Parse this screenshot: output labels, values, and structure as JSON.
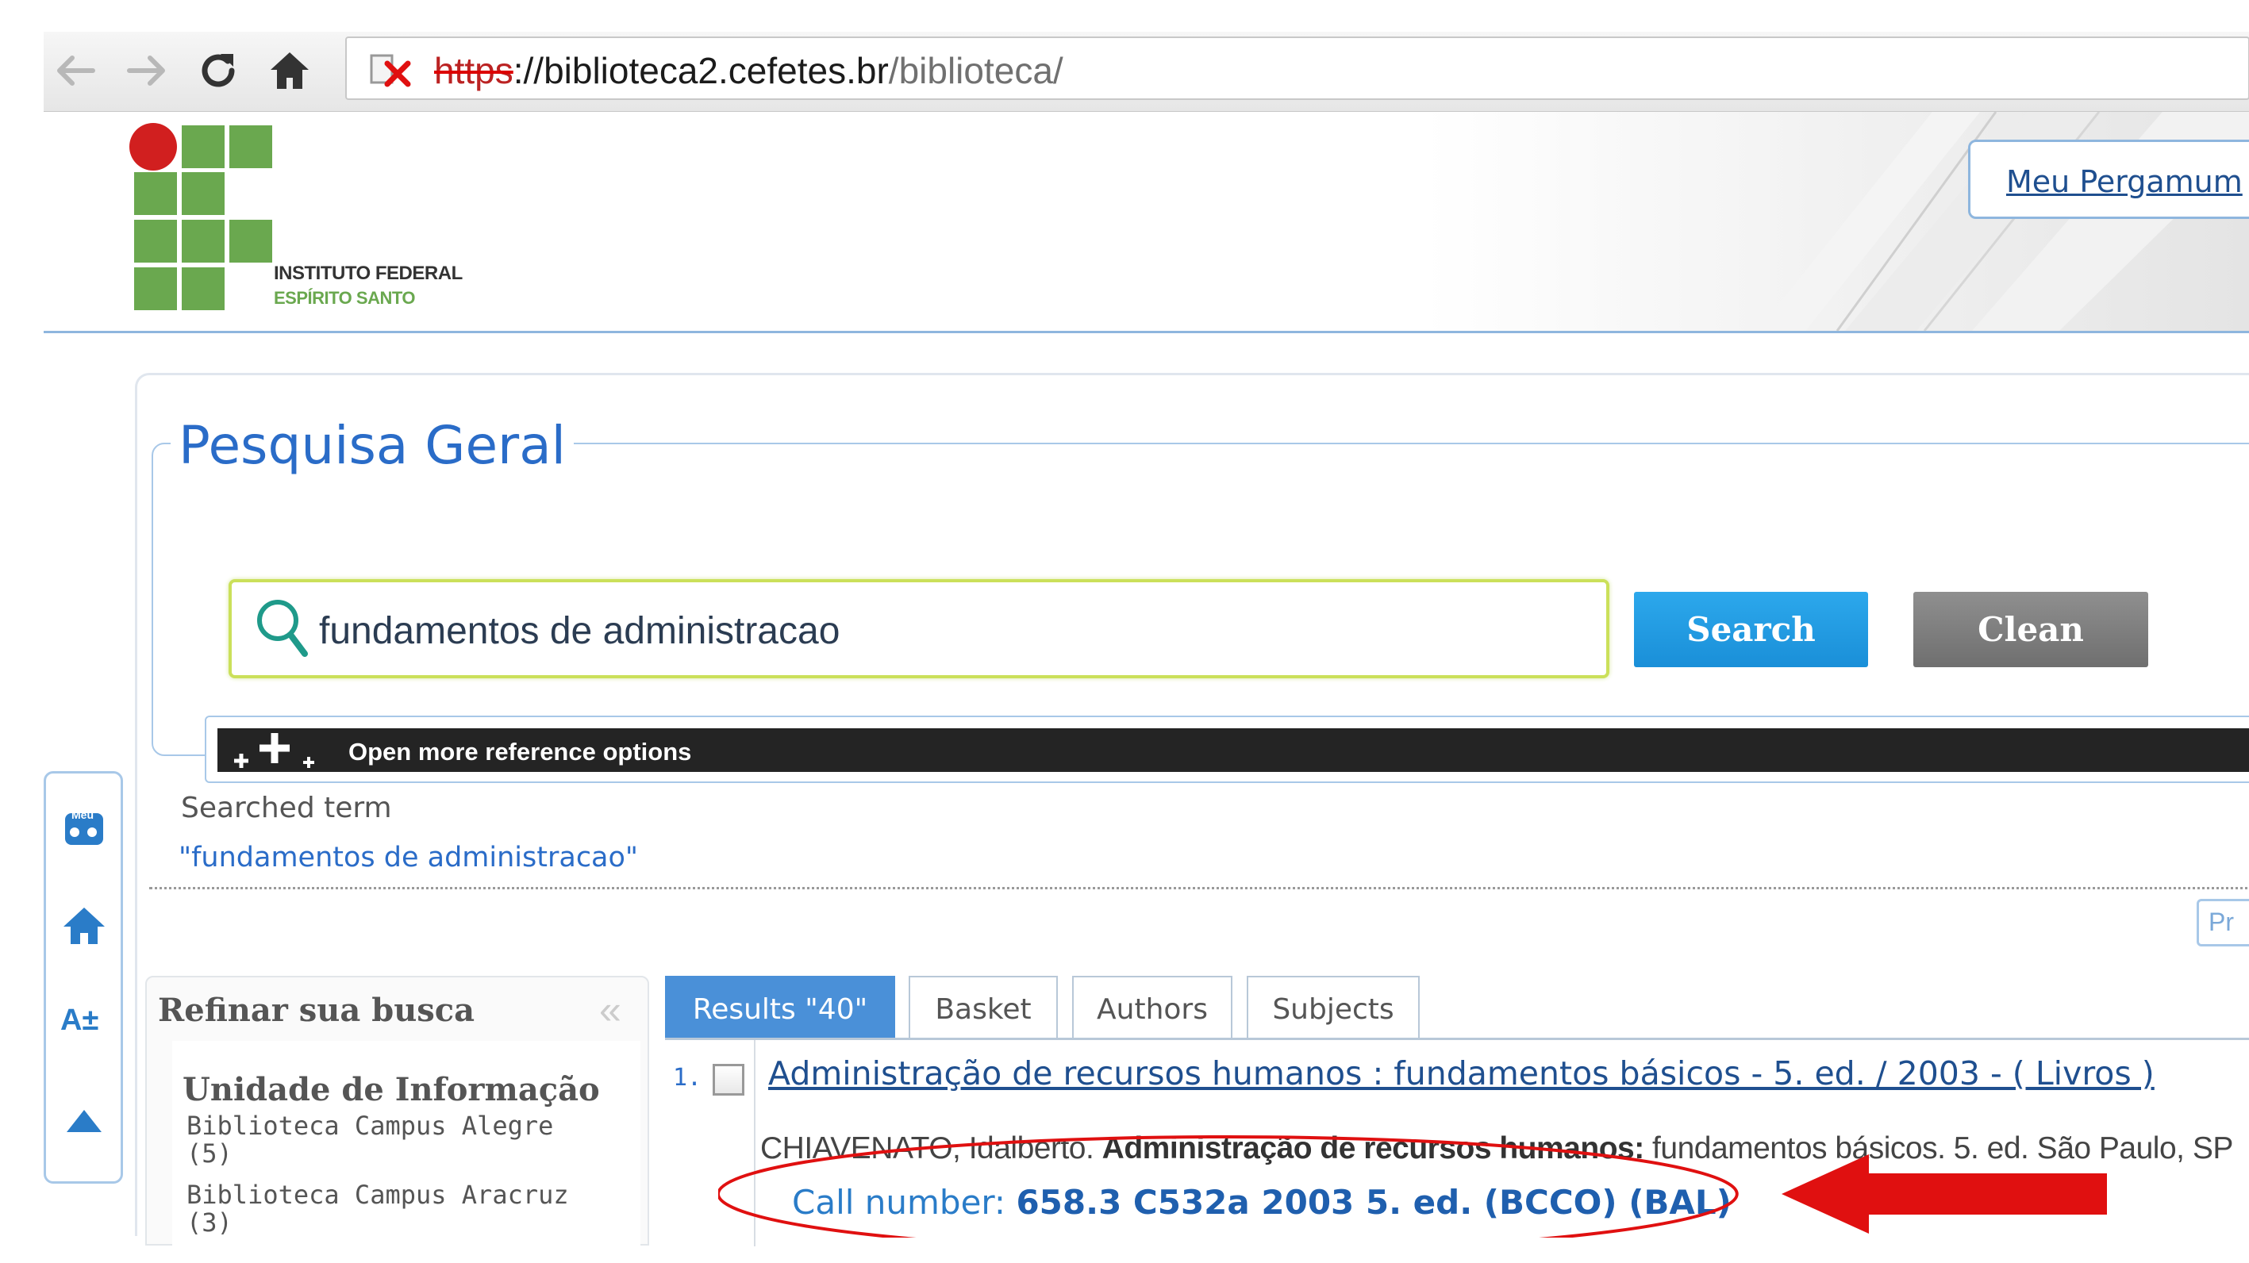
{
  "browser": {
    "url_scheme": "https",
    "url_host": "://biblioteca2.cefetes.br",
    "url_path": "/biblioteca/"
  },
  "header": {
    "institution_line1": "INSTITUTO FEDERAL",
    "institution_line2": "ESPÍRITO SANTO",
    "meu_pergamum": "Meu Pergamum"
  },
  "search": {
    "legend": "Pesquisa Geral",
    "query": "fundamentos de administracao",
    "search_label": "Search",
    "clean_label": "Clean",
    "more_options_label": "Open more reference options"
  },
  "searched": {
    "label": "Searched term",
    "value": "\"fundamentos de administracao\""
  },
  "pr_button": "Pr",
  "toolbar": {
    "meu_label": "Meu",
    "font_label": "A±"
  },
  "refine": {
    "title": "Refinar sua busca",
    "collapse": "«",
    "unidade_title": "Unidade de Informação",
    "items": [
      {
        "name": "Biblioteca Campus Alegre",
        "count": "(5)"
      },
      {
        "name": "Biblioteca Campus Aracruz",
        "count": "(3)"
      }
    ]
  },
  "tabs": {
    "results": "Results \"40\"",
    "basket": "Basket",
    "authors": "Authors",
    "subjects": "Subjects"
  },
  "result": {
    "number": "1.",
    "title": "Administração de recursos humanos : fundamentos básicos - 5. ed. / 2003 - ( Livros )",
    "author": "CHIAVENATO, Idalberto.",
    "work_title": "Administração de recursos humanos:",
    "rest": " fundamentos básicos. 5. ed. São Paulo, SP",
    "call_label": "Call number: ",
    "call_value": "658.3 C532a 2003 5. ed. (BCCO) (BAL)"
  },
  "colors": {
    "accent_blue": "#2a6cc8",
    "search_button": "#1a8fd8",
    "clean_button": "#7a7a7a",
    "logo_green": "#6aa84f",
    "logo_red": "#d11f1f",
    "annotation_red": "#e01010"
  },
  "icons": [
    "back-arrow-icon",
    "forward-arrow-icon",
    "reload-icon",
    "home-icon",
    "insecure-lock-icon",
    "search-magnifier-icon",
    "plus-icon",
    "home-blue-icon",
    "up-arrow-icon"
  ]
}
